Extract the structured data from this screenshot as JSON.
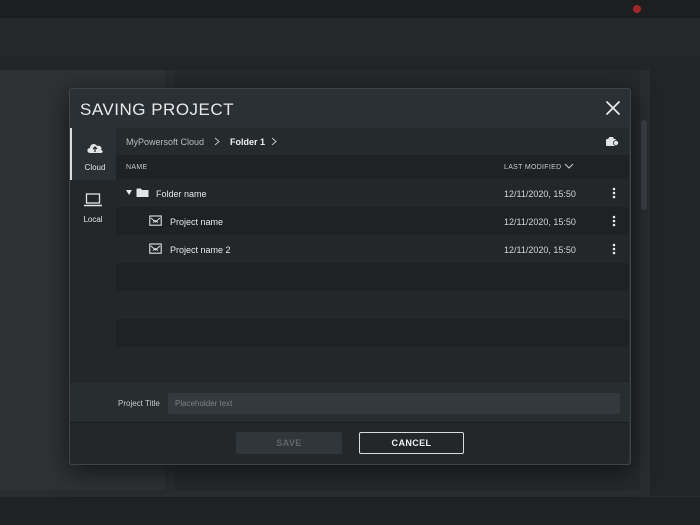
{
  "dialog": {
    "title": "SAVING PROJECT",
    "sidebar": [
      {
        "label": "Cloud",
        "icon": "cloud-icon",
        "active": true
      },
      {
        "label": "Local",
        "icon": "laptop-icon",
        "active": false
      }
    ],
    "breadcrumb": [
      "MyPowersoft Cloud",
      "Folder 1"
    ],
    "columns": {
      "name": "NAME",
      "last_modified": "LAST MODIFIED"
    },
    "rows": [
      {
        "name": "Folder name",
        "type": "folder",
        "expanded": true,
        "last_modified": "12/11/2020, 15:50"
      },
      {
        "name": "Project name",
        "type": "project",
        "last_modified": "12/11/2020, 15:50"
      },
      {
        "name": "Project name 2",
        "type": "project",
        "last_modified": "12/11/2020, 15:50"
      }
    ],
    "project_title": {
      "label": "Project Title",
      "placeholder": "Placeholder text",
      "value": ""
    },
    "buttons": {
      "save": "SAVE",
      "cancel": "CANCEL"
    },
    "colors": {
      "background": "#2b3034",
      "list": "#1e2225",
      "accent": "#d9dcde"
    }
  }
}
